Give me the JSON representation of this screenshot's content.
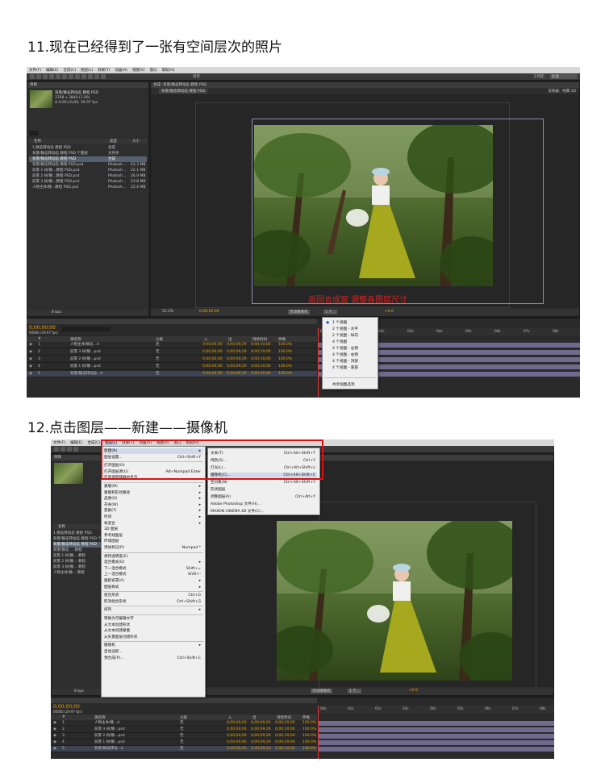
{
  "step11": {
    "title": "11.现在已经得到了一张有空间层次的照片",
    "menubar": [
      "文件(F)",
      "编辑(E)",
      "合成(C)",
      "图层(L)",
      "效果(T)",
      "动画(A)",
      "视图(V)",
      "窗口",
      "帮助(H)"
    ],
    "workspace_label": "工作区：",
    "workspace_value": "标准",
    "snap_label": "对齐",
    "project_tab": "项目",
    "composition_tab": "合成: 背景/静态转动态 教程 PSD",
    "comp_sub_tab": "背景/静态转动态 教程 PSD",
    "renderer_label": "渲染器：经典 3D",
    "active_camera": "活动摄像机",
    "project_item_name": "背景/静态转动态 教程 PSD",
    "project_item_info1": "3768 x 3840 (1.00)",
    "project_item_info2": "Δ 0;00;10;00, 29.97 fps",
    "col_name": "名称",
    "col_type": "类型",
    "col_size": "大小",
    "project_rows": [
      {
        "name": "1 静态转动态 教程 PSD",
        "type": "合成",
        "size": ""
      },
      {
        "name": "背景/静态转动态 教程 PSD 个图层",
        "type": "文件夹",
        "size": ""
      },
      {
        "name": "背景/静态转动态 教程 PSD",
        "type": "合成",
        "size": ""
      },
      {
        "name": "背景/静态转动态 教程 PSD.psd",
        "type": "Photosh...",
        "size": "63.3 MB"
      },
      {
        "name": "前景 1 树/静...教程 PSD.psd",
        "type": "Photosh...",
        "size": "22.1 MB"
      },
      {
        "name": "前景 2 树/静...教程 PSD.psd",
        "type": "Photosh...",
        "size": "26.9 MB"
      },
      {
        "name": "前景 3 树/静...教程 PSD.psd",
        "type": "Photosh...",
        "size": "23.8 MB"
      },
      {
        "name": "人物主体/静...教程 PSD.psd",
        "type": "Photosh...",
        "size": "22.4 MB"
      }
    ],
    "bpc": "8 bpc",
    "zoom": "52.2%",
    "viewer_time": "0;00;00;00",
    "view_mode": "1 个...",
    "exposure": "+0.0",
    "timeline_timecode": "0;00;00;00",
    "timeline_fps": "00000 (29.97 fps)",
    "layer_header": [
      "#",
      "源名称",
      "父级",
      "入",
      "出",
      "持续时间",
      "伸缩"
    ],
    "layers": [
      {
        "num": "1",
        "name": "人物主体/静态...d",
        "parent": "无",
        "in": "0;00;00;00",
        "out": "0;00;09;29",
        "dur": "0;00;10;00",
        "stretch": "100.0%"
      },
      {
        "name": "前景 3 树/静...psd",
        "num": "2",
        "parent": "无",
        "in": "0;00;00;00",
        "out": "0;00;09;29",
        "dur": "0;00;10;00",
        "stretch": "100.0%"
      },
      {
        "name": "前景 2 树/静...psd",
        "num": "3",
        "parent": "无",
        "in": "0;00;00;00",
        "out": "0;00;09;29",
        "dur": "0;00;10;00",
        "stretch": "100.0%"
      },
      {
        "name": "前景 1 树/静...psd",
        "num": "4",
        "parent": "无",
        "in": "0;00;00;00",
        "out": "0;00;09;29",
        "dur": "0;00;10;00",
        "stretch": "100.0%"
      },
      {
        "name": "背景/静态转动态...d",
        "num": "5",
        "parent": "无",
        "in": "0;00;00;00",
        "out": "0;00;09;29",
        "dur": "0;00;10;00",
        "stretch": "100.0%"
      }
    ],
    "ruler": [
      "00s",
      "01s",
      "02s",
      "03s",
      "04s",
      "05s",
      "06s",
      "07s",
      "08s",
      "09s"
    ],
    "caption": "返回合成窗 调整各图层尺寸",
    "view_menu": [
      "1 个视图",
      "2 个视图 - 水平",
      "2 个视图 - 纵向",
      "4 个视图",
      "4 个视图 - 左侧",
      "4 个视图 - 右侧",
      "4 个视图 - 顶部",
      "4 个视图 - 底部",
      "共享视图选项"
    ],
    "comp_label": "活动摄像机"
  },
  "step12": {
    "title": "12.点击图层——新建——摄像机",
    "menubar": [
      "文件(F)",
      "编辑(E)",
      "合成(C)",
      "图层(L)",
      "效果(T)",
      "动画(A)",
      "视图(V)",
      "窗口",
      "帮助(H)"
    ],
    "project_tab": "项目",
    "col_name": "名称",
    "project_rows": [
      "1 静态转动态 教程 PSD",
      "背景/静态转动态 教程 PSD 个图层",
      "背景/静态转动态 教程 PSD",
      "背景/静态 ... 教程",
      "前景 1 树/静... 教程",
      "前景 2 树/静... 教程",
      "前景 3 树/静... 教程",
      "人物主体/静... 教程"
    ],
    "bpc": "8 bpc",
    "layer_menu": [
      {
        "label": "新建(N)",
        "sc": "",
        "arrow": true,
        "hl": true
      },
      {
        "label": "图层设置...",
        "sc": "Ctrl+Shift+Y"
      },
      {
        "sep": true
      },
      {
        "label": "打开图层(O)",
        "sc": ""
      },
      {
        "label": "打开图层源(U)",
        "sc": "Alt+Numpad Enter"
      },
      {
        "label": "在资源管理器中显示",
        "sc": ""
      },
      {
        "sep": true
      },
      {
        "label": "蒙版(M)",
        "sc": "",
        "arrow": true
      },
      {
        "label": "蒙版和形状路径",
        "sc": "",
        "arrow": true
      },
      {
        "label": "品质(Q)",
        "sc": "",
        "arrow": true
      },
      {
        "label": "开关(W)",
        "sc": "",
        "arrow": true
      },
      {
        "label": "变换(T)",
        "sc": "",
        "arrow": true
      },
      {
        "label": "时间",
        "sc": "",
        "arrow": true
      },
      {
        "label": "帧混合",
        "sc": "",
        "arrow": true
      },
      {
        "label": "3D 图层",
        "sc": ""
      },
      {
        "label": "参考线图层",
        "sc": ""
      },
      {
        "label": "环境图层",
        "sc": ""
      },
      {
        "label": "添加标记(R)",
        "sc": "Numpad *"
      },
      {
        "sep": true
      },
      {
        "label": "保持透明度(E)",
        "sc": ""
      },
      {
        "label": "混合模式(D)",
        "sc": "",
        "arrow": true
      },
      {
        "label": "下一混合模式",
        "sc": "Shift+="
      },
      {
        "label": "上一混合模式",
        "sc": "Shift+-"
      },
      {
        "label": "跟踪遮罩(A)",
        "sc": "",
        "arrow": true
      },
      {
        "label": "图层样式",
        "sc": "",
        "arrow": true
      },
      {
        "sep": true
      },
      {
        "label": "组合形状",
        "sc": "Ctrl+G"
      },
      {
        "label": "取消组合形状",
        "sc": "Ctrl+Shift+G"
      },
      {
        "sep": true
      },
      {
        "label": "排列",
        "sc": "",
        "arrow": true
      },
      {
        "sep": true
      },
      {
        "label": "转换为可编辑文字",
        "sc": ""
      },
      {
        "label": "从文本创建形状",
        "sc": ""
      },
      {
        "label": "从文本创建蒙版",
        "sc": ""
      },
      {
        "label": "从矢量图层创建形状",
        "sc": ""
      },
      {
        "sep": true
      },
      {
        "label": "摄像机",
        "sc": "",
        "arrow": true
      },
      {
        "label": "自动追踪...",
        "sc": ""
      },
      {
        "label": "预合成(P)...",
        "sc": "Ctrl+Shift+C"
      }
    ],
    "new_menu": [
      {
        "label": "文本(T)",
        "sc": "Ctrl+Alt+Shift+T"
      },
      {
        "label": "纯色(S)...",
        "sc": "Ctrl+Y"
      },
      {
        "label": "灯光(L)...",
        "sc": "Ctrl+Alt+Shift+L"
      },
      {
        "label": "摄像机(C)...",
        "sc": "Ctrl+Alt+Shift+C",
        "hl": true
      },
      {
        "label": "空对象(N)",
        "sc": "Ctrl+Alt+Shift+Y"
      },
      {
        "label": "形状图层",
        "sc": ""
      },
      {
        "label": "调整图层(A)",
        "sc": "Ctrl+Alt+Y"
      },
      {
        "label": "Adobe Photoshop 文件(H)...",
        "sc": ""
      },
      {
        "label": "MAXON CINEMA 4D 文件(C)...",
        "sc": ""
      }
    ],
    "active_camera": "活动摄像机",
    "view_mode": "1 个...",
    "exposure": "+0.0",
    "timeline_timecode": "0;00;00;00",
    "timeline_fps": "00000 (29.97 fps)",
    "layer_header": [
      "#",
      "源名称",
      "父级",
      "入",
      "出",
      "持续时间",
      "伸缩"
    ],
    "layers": [
      {
        "num": "1",
        "name": "人物主体/静...d",
        "parent": "无",
        "in": "0;00;00;00",
        "out": "0;00;09;29",
        "dur": "0;00;10;00",
        "stretch": "100.0%"
      },
      {
        "num": "2",
        "name": "前景 3 树/静...psd",
        "parent": "无",
        "in": "0;00;00;00",
        "out": "0;00;09;29",
        "dur": "0;00;10;00",
        "stretch": "100.0%"
      },
      {
        "num": "3",
        "name": "前景 2 树/静...psd",
        "parent": "无",
        "in": "0;00;00;00",
        "out": "0;00;09;29",
        "dur": "0;00;10;00",
        "stretch": "100.0%"
      },
      {
        "num": "4",
        "name": "前景 1 树/静...psd",
        "parent": "无",
        "in": "0;00;00;00",
        "out": "0;00;09;29",
        "dur": "0;00;10;00",
        "stretch": "100.0%"
      },
      {
        "num": "5",
        "name": "背景/静态转动...d",
        "parent": "无",
        "in": "0;00;00;00",
        "out": "0;00;09;29",
        "dur": "0;00;10;00",
        "stretch": "100.0%"
      }
    ],
    "ruler": [
      "00s",
      "01s",
      "02s",
      "03s",
      "04s",
      "05s",
      "06s",
      "07s",
      "08s"
    ]
  }
}
